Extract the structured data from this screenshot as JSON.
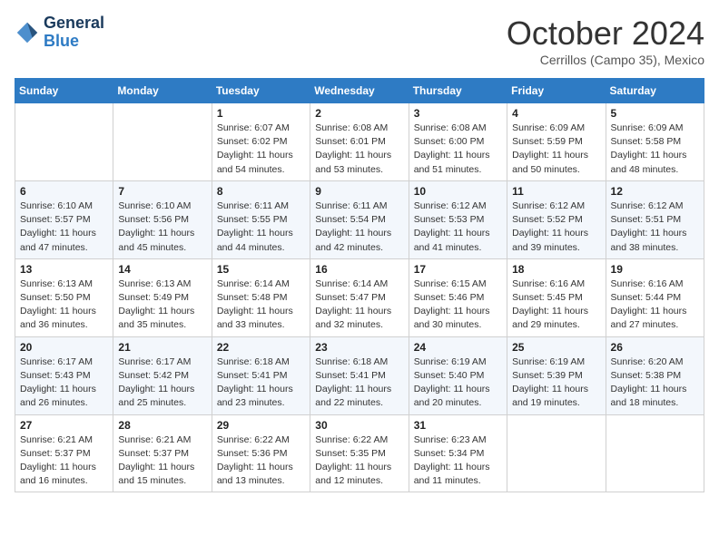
{
  "logo": {
    "line1": "General",
    "line2": "Blue"
  },
  "header": {
    "month": "October 2024",
    "location": "Cerrillos (Campo 35), Mexico"
  },
  "days_of_week": [
    "Sunday",
    "Monday",
    "Tuesday",
    "Wednesday",
    "Thursday",
    "Friday",
    "Saturday"
  ],
  "weeks": [
    [
      {
        "day": "",
        "info": ""
      },
      {
        "day": "",
        "info": ""
      },
      {
        "day": "1",
        "info": "Sunrise: 6:07 AM\nSunset: 6:02 PM\nDaylight: 11 hours and 54 minutes."
      },
      {
        "day": "2",
        "info": "Sunrise: 6:08 AM\nSunset: 6:01 PM\nDaylight: 11 hours and 53 minutes."
      },
      {
        "day": "3",
        "info": "Sunrise: 6:08 AM\nSunset: 6:00 PM\nDaylight: 11 hours and 51 minutes."
      },
      {
        "day": "4",
        "info": "Sunrise: 6:09 AM\nSunset: 5:59 PM\nDaylight: 11 hours and 50 minutes."
      },
      {
        "day": "5",
        "info": "Sunrise: 6:09 AM\nSunset: 5:58 PM\nDaylight: 11 hours and 48 minutes."
      }
    ],
    [
      {
        "day": "6",
        "info": "Sunrise: 6:10 AM\nSunset: 5:57 PM\nDaylight: 11 hours and 47 minutes."
      },
      {
        "day": "7",
        "info": "Sunrise: 6:10 AM\nSunset: 5:56 PM\nDaylight: 11 hours and 45 minutes."
      },
      {
        "day": "8",
        "info": "Sunrise: 6:11 AM\nSunset: 5:55 PM\nDaylight: 11 hours and 44 minutes."
      },
      {
        "day": "9",
        "info": "Sunrise: 6:11 AM\nSunset: 5:54 PM\nDaylight: 11 hours and 42 minutes."
      },
      {
        "day": "10",
        "info": "Sunrise: 6:12 AM\nSunset: 5:53 PM\nDaylight: 11 hours and 41 minutes."
      },
      {
        "day": "11",
        "info": "Sunrise: 6:12 AM\nSunset: 5:52 PM\nDaylight: 11 hours and 39 minutes."
      },
      {
        "day": "12",
        "info": "Sunrise: 6:12 AM\nSunset: 5:51 PM\nDaylight: 11 hours and 38 minutes."
      }
    ],
    [
      {
        "day": "13",
        "info": "Sunrise: 6:13 AM\nSunset: 5:50 PM\nDaylight: 11 hours and 36 minutes."
      },
      {
        "day": "14",
        "info": "Sunrise: 6:13 AM\nSunset: 5:49 PM\nDaylight: 11 hours and 35 minutes."
      },
      {
        "day": "15",
        "info": "Sunrise: 6:14 AM\nSunset: 5:48 PM\nDaylight: 11 hours and 33 minutes."
      },
      {
        "day": "16",
        "info": "Sunrise: 6:14 AM\nSunset: 5:47 PM\nDaylight: 11 hours and 32 minutes."
      },
      {
        "day": "17",
        "info": "Sunrise: 6:15 AM\nSunset: 5:46 PM\nDaylight: 11 hours and 30 minutes."
      },
      {
        "day": "18",
        "info": "Sunrise: 6:16 AM\nSunset: 5:45 PM\nDaylight: 11 hours and 29 minutes."
      },
      {
        "day": "19",
        "info": "Sunrise: 6:16 AM\nSunset: 5:44 PM\nDaylight: 11 hours and 27 minutes."
      }
    ],
    [
      {
        "day": "20",
        "info": "Sunrise: 6:17 AM\nSunset: 5:43 PM\nDaylight: 11 hours and 26 minutes."
      },
      {
        "day": "21",
        "info": "Sunrise: 6:17 AM\nSunset: 5:42 PM\nDaylight: 11 hours and 25 minutes."
      },
      {
        "day": "22",
        "info": "Sunrise: 6:18 AM\nSunset: 5:41 PM\nDaylight: 11 hours and 23 minutes."
      },
      {
        "day": "23",
        "info": "Sunrise: 6:18 AM\nSunset: 5:41 PM\nDaylight: 11 hours and 22 minutes."
      },
      {
        "day": "24",
        "info": "Sunrise: 6:19 AM\nSunset: 5:40 PM\nDaylight: 11 hours and 20 minutes."
      },
      {
        "day": "25",
        "info": "Sunrise: 6:19 AM\nSunset: 5:39 PM\nDaylight: 11 hours and 19 minutes."
      },
      {
        "day": "26",
        "info": "Sunrise: 6:20 AM\nSunset: 5:38 PM\nDaylight: 11 hours and 18 minutes."
      }
    ],
    [
      {
        "day": "27",
        "info": "Sunrise: 6:21 AM\nSunset: 5:37 PM\nDaylight: 11 hours and 16 minutes."
      },
      {
        "day": "28",
        "info": "Sunrise: 6:21 AM\nSunset: 5:37 PM\nDaylight: 11 hours and 15 minutes."
      },
      {
        "day": "29",
        "info": "Sunrise: 6:22 AM\nSunset: 5:36 PM\nDaylight: 11 hours and 13 minutes."
      },
      {
        "day": "30",
        "info": "Sunrise: 6:22 AM\nSunset: 5:35 PM\nDaylight: 11 hours and 12 minutes."
      },
      {
        "day": "31",
        "info": "Sunrise: 6:23 AM\nSunset: 5:34 PM\nDaylight: 11 hours and 11 minutes."
      },
      {
        "day": "",
        "info": ""
      },
      {
        "day": "",
        "info": ""
      }
    ]
  ]
}
